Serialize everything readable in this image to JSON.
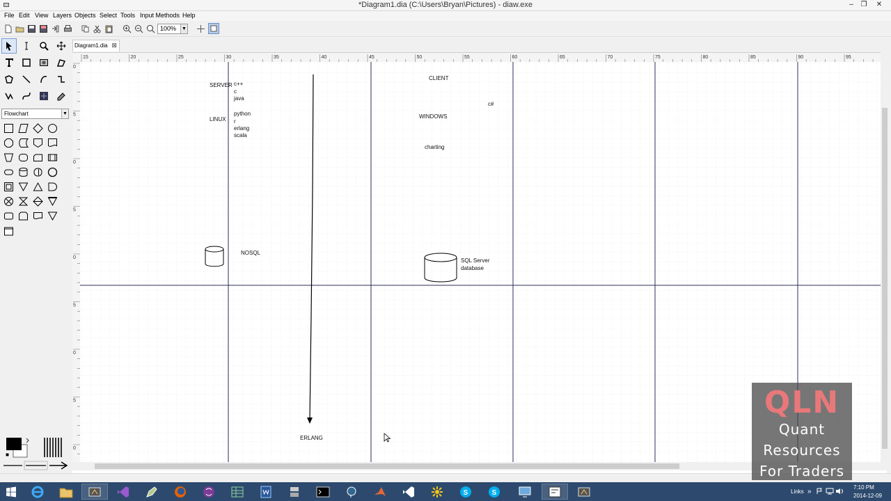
{
  "window": {
    "title": "*Diagram1.dia (C:\\Users\\Bryan\\Pictures) - diaw.exe"
  },
  "menu": [
    "File",
    "Edit",
    "View",
    "Layers",
    "Objects",
    "Select",
    "Tools",
    "Input Methods",
    "Help"
  ],
  "toolbar": {
    "zoom": "100%"
  },
  "toolbox": {
    "sheet": "Flowchart"
  },
  "tab": {
    "label": "Diagram1.dia",
    "close": "⊠"
  },
  "rulers": {
    "top": [
      "15",
      "20",
      "25",
      "30",
      "35",
      "40",
      "45",
      "50",
      "55",
      "60",
      "65",
      "70",
      "75",
      "80",
      "85",
      "90",
      "95",
      "10"
    ],
    "left": [
      "0",
      "5",
      "0",
      "5",
      "0",
      "5",
      "0",
      "5",
      "0"
    ]
  },
  "diagram": {
    "server_label": "SERVER",
    "server_langs": [
      "c++",
      "c",
      "java"
    ],
    "linux_label": "LINUX",
    "linux_langs": [
      "python",
      "r",
      "erlang",
      "scala"
    ],
    "client_label": "CLIENT",
    "client_lang": "c#",
    "windows_label": "WINDOWS",
    "charting_label": "charting",
    "nosql_label": "NOSQL",
    "sqlserver_label_1": "SQL Server",
    "sqlserver_label_2": "database",
    "erlang_label": "ERLANG"
  },
  "taskbar": {
    "links": "Links",
    "time": "7:10 PM",
    "date": "2014-12-09"
  },
  "watermark": {
    "logo": "QLN",
    "line1": "Quant",
    "line2": "Resources",
    "line3": "For Traders"
  }
}
